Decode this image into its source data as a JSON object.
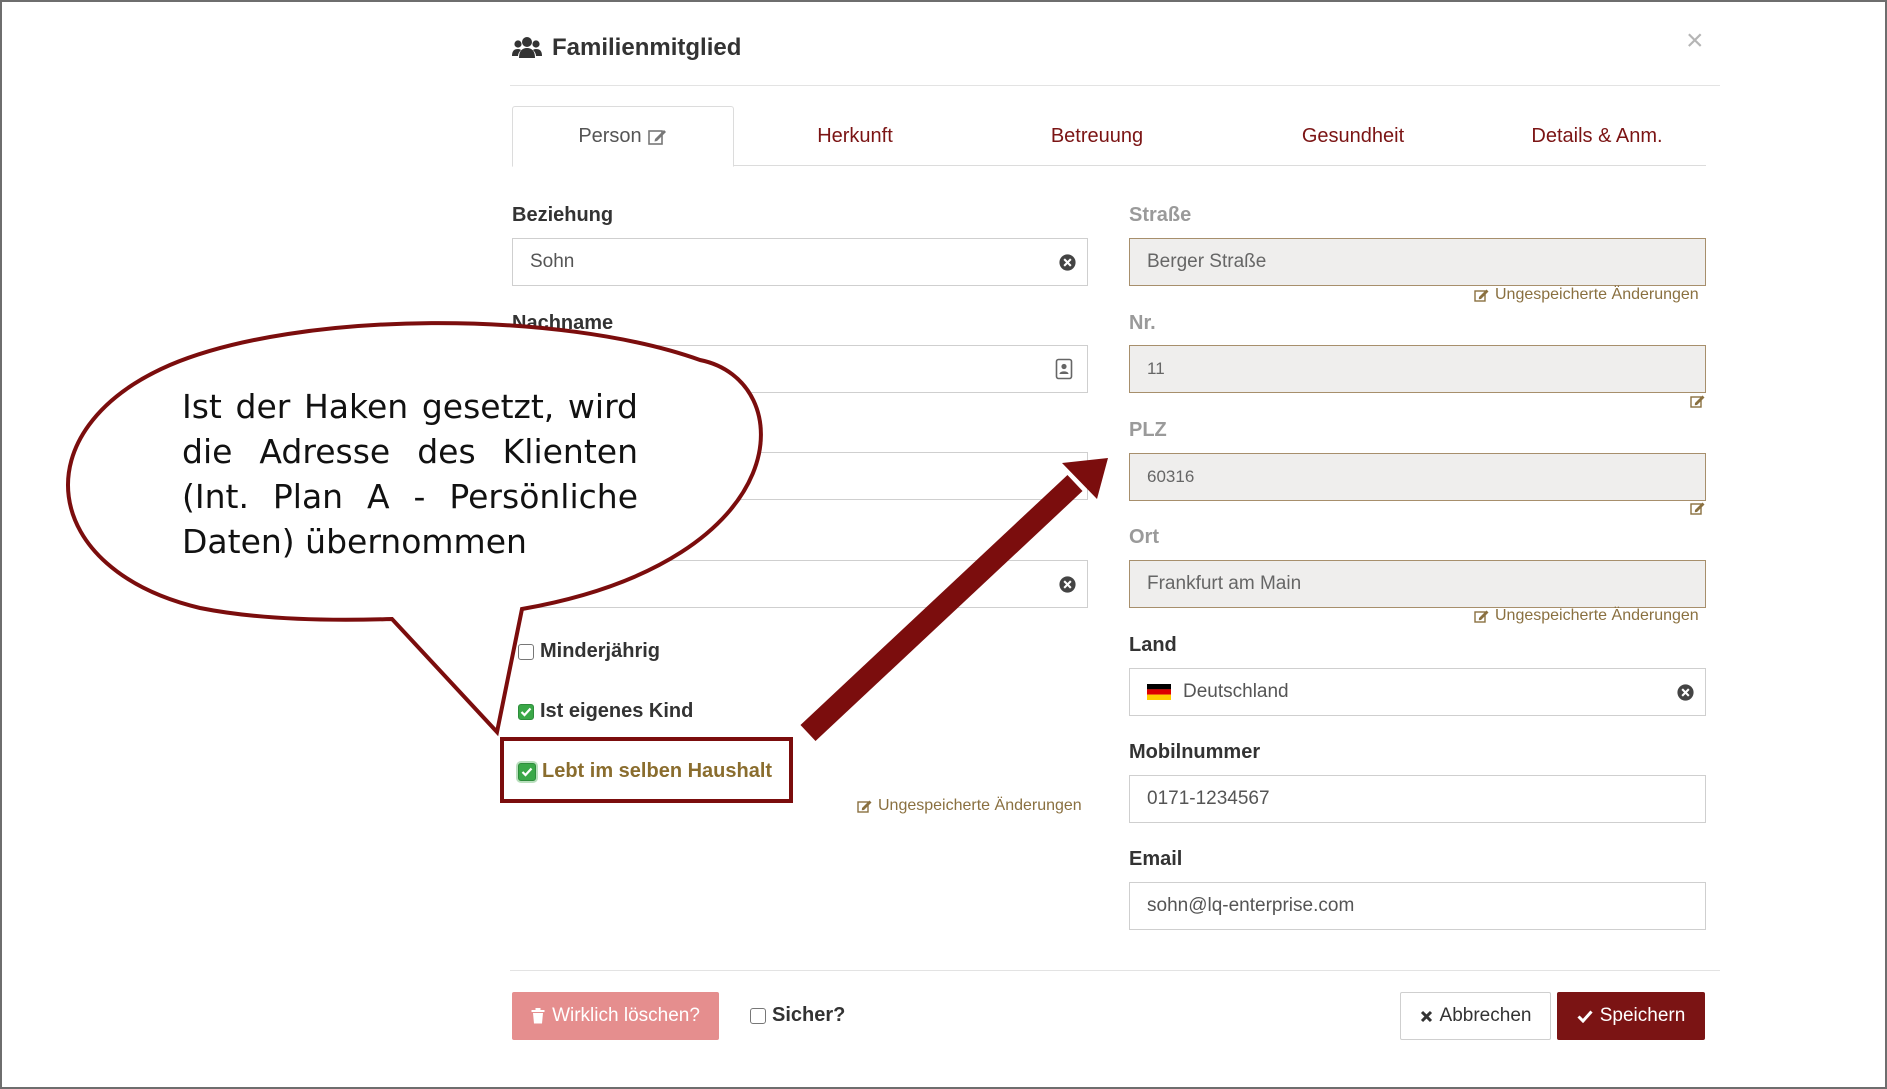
{
  "modal": {
    "title": "Familienmitglied",
    "title_icon": "users-icon",
    "close_glyph": "×"
  },
  "tabs": [
    {
      "label": "Person",
      "active": true,
      "icon": "edit-icon"
    },
    {
      "label": "Herkunft"
    },
    {
      "label": "Betreuung"
    },
    {
      "label": "Gesundheit"
    },
    {
      "label": "Details & Anm."
    }
  ],
  "left": {
    "beziehung": {
      "label": "Beziehung",
      "value": "Sohn"
    },
    "nachname": {
      "label": "Nachname",
      "value": ""
    },
    "field3": {
      "value": ""
    },
    "field4": {
      "value": ""
    },
    "checkboxes": [
      {
        "label": "Minderjährig",
        "checked": false
      },
      {
        "label": "Ist eigenes Kind",
        "checked": true
      },
      {
        "label": "Lebt im selben Haushalt",
        "checked": true
      }
    ],
    "unsaved": "Ungespeicherte Änderungen"
  },
  "right": {
    "strasse": {
      "label": "Straße",
      "value": "Berger Straße",
      "unsaved": "Ungespeicherte Änderungen"
    },
    "nr": {
      "label": "Nr.",
      "value": "11"
    },
    "plz": {
      "label": "PLZ",
      "value": "60316"
    },
    "ort": {
      "label": "Ort",
      "value": "Frankfurt am Main",
      "unsaved": "Ungespeicherte Änderungen"
    },
    "land": {
      "label": "Land",
      "value": "Deutschland",
      "flag": "de-flag-icon"
    },
    "mobil": {
      "label": "Mobilnummer",
      "value": "0171-1234567"
    },
    "email": {
      "label": "Email",
      "value": "sohn@lq-enterprise.com"
    }
  },
  "footer": {
    "delete_label": "Wirklich löschen?",
    "sure_label": "Sicher?",
    "cancel_label": "Abbrechen",
    "save_label": "Speichern"
  },
  "annotation": {
    "callout_text": "Ist der Haken gesetzt, wird die Adresse des Klienten (Int. Plan A - Persönliche Daten) übernommen"
  },
  "colors": {
    "accent": "#7b1414",
    "delete": "#e58e8e",
    "checked": "#3aa848",
    "readonly_border": "#a78f6c",
    "readonly_bg": "#efeeed"
  }
}
